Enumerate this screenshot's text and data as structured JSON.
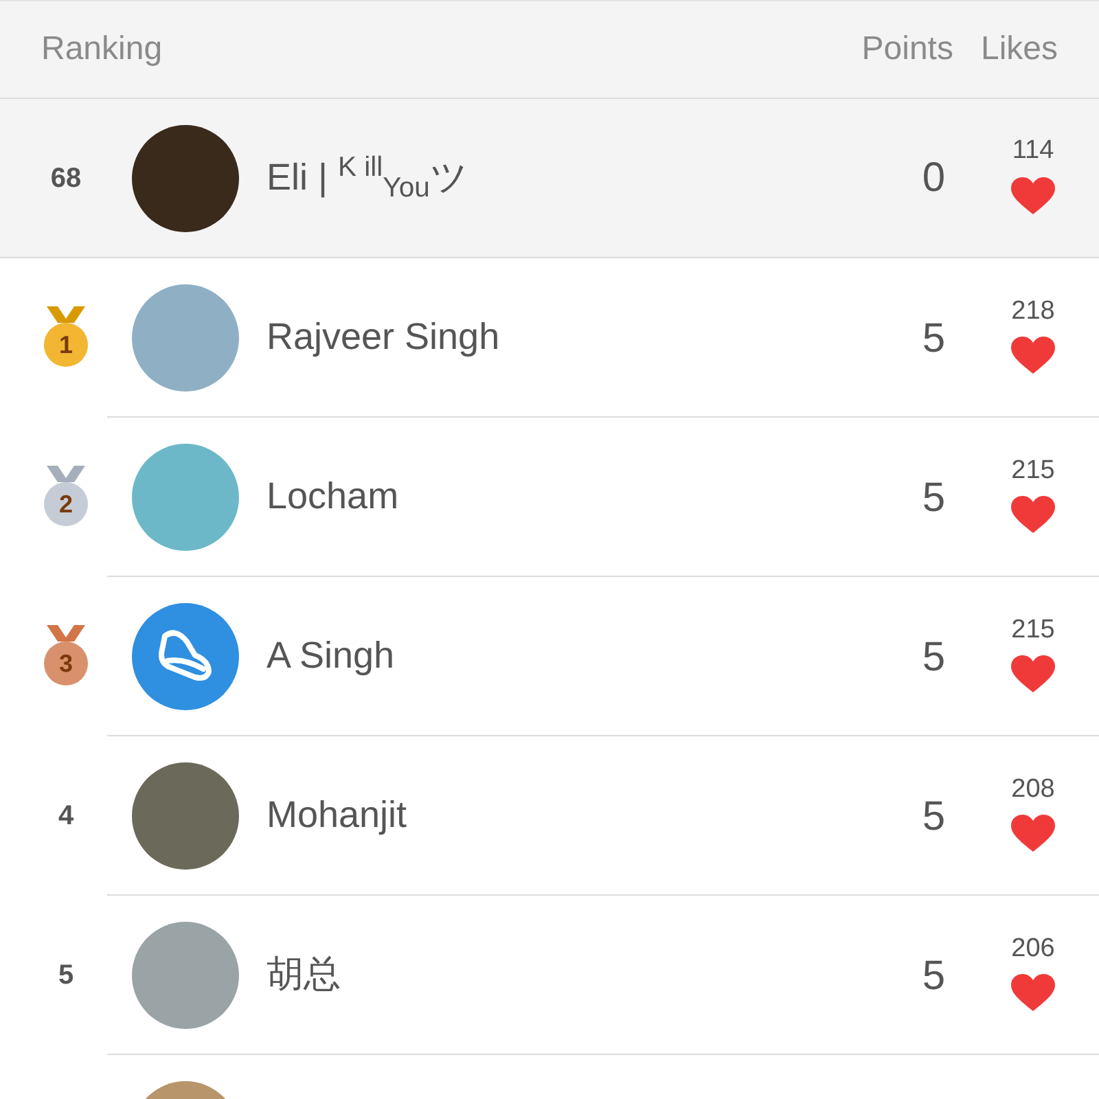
{
  "header": {
    "ranking": "Ranking",
    "points": "Points",
    "likes": "Likes"
  },
  "rows": [
    {
      "kind": "plain",
      "rank": "68",
      "name": "Eli | $^{K ill}$$_{You}$ツ",
      "points": "0",
      "likes": "114",
      "selected": true,
      "avatar_icon": false
    },
    {
      "kind": "medal",
      "rank": "1",
      "color": "#f2b632",
      "name": "Rajveer Singh",
      "points": "5",
      "likes": "218",
      "selected": false,
      "avatar_icon": false
    },
    {
      "kind": "medal",
      "rank": "2",
      "color": "#c5ccd6",
      "name": "Locham",
      "points": "5",
      "likes": "215",
      "selected": false,
      "avatar_icon": false
    },
    {
      "kind": "medal",
      "rank": "3",
      "color": "#d9906c",
      "name": "A Singh",
      "points": "5",
      "likes": "215",
      "selected": false,
      "avatar_icon": true
    },
    {
      "kind": "plain",
      "rank": "4",
      "name": "Mohanjit",
      "points": "5",
      "likes": "208",
      "selected": false,
      "avatar_icon": false
    },
    {
      "kind": "plain",
      "rank": "5",
      "name": "胡总",
      "points": "5",
      "likes": "206",
      "selected": false,
      "avatar_icon": false
    }
  ],
  "partial_row": {
    "avatar_icon": false
  }
}
